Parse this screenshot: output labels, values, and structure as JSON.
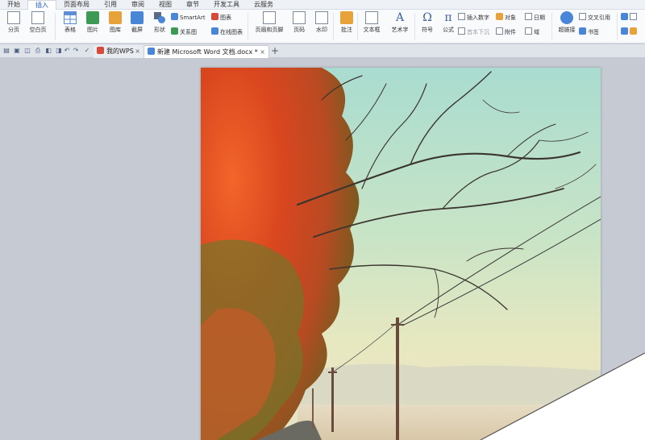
{
  "menu_tabs": [
    "开始",
    "插入",
    "页面布局",
    "引用",
    "审阅",
    "视图",
    "章节",
    "开发工具",
    "云服务"
  ],
  "active_tab": "插入",
  "ribbon": {
    "page_break": "分页",
    "blank_page": "空白页",
    "table": "表格",
    "picture": "图片",
    "gallery": "图库",
    "screenshot": "截屏",
    "shapes": "形状",
    "smartart": "SmartArt",
    "chart": "图表",
    "relation_chart": "关系图",
    "online_chart": "在线图表",
    "header_footer": "页眉和页脚",
    "page_number": "页码",
    "watermark": "水印",
    "comment": "批注",
    "textbox": "文本框",
    "wordart": "艺术字",
    "symbol": "符号",
    "formula": "公式",
    "insert_number": "插入数字",
    "object": "对象",
    "date": "日期",
    "text_from_file": "首本下沉",
    "attachment": "附件",
    "field": "域",
    "hyperlink": "超链接",
    "cross_reference": "交叉引用",
    "bookmark": "书签"
  },
  "tabs": {
    "my_wps": "我的WPS",
    "document": "新建 Microsoft Word 文档.docx *",
    "close": "×",
    "new": "+"
  },
  "colors": {
    "accent": "#1f5fc8",
    "workspace": "#c6cad2"
  }
}
